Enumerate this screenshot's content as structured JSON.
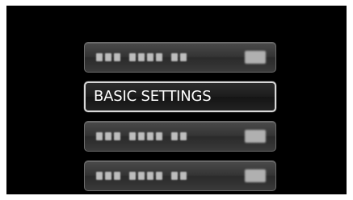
{
  "menu": {
    "items": [
      {
        "label": "",
        "state": "dim",
        "icon": "placeholder-icon"
      },
      {
        "label": "BASIC SETTINGS",
        "state": "active",
        "icon": ""
      },
      {
        "label": "",
        "state": "dim",
        "icon": "placeholder-icon"
      },
      {
        "label": "",
        "state": "dim",
        "icon": "placeholder-icon"
      }
    ]
  },
  "colors": {
    "screen": "#000000",
    "active_border": "#d8d8d8",
    "text": "#ffffff"
  }
}
